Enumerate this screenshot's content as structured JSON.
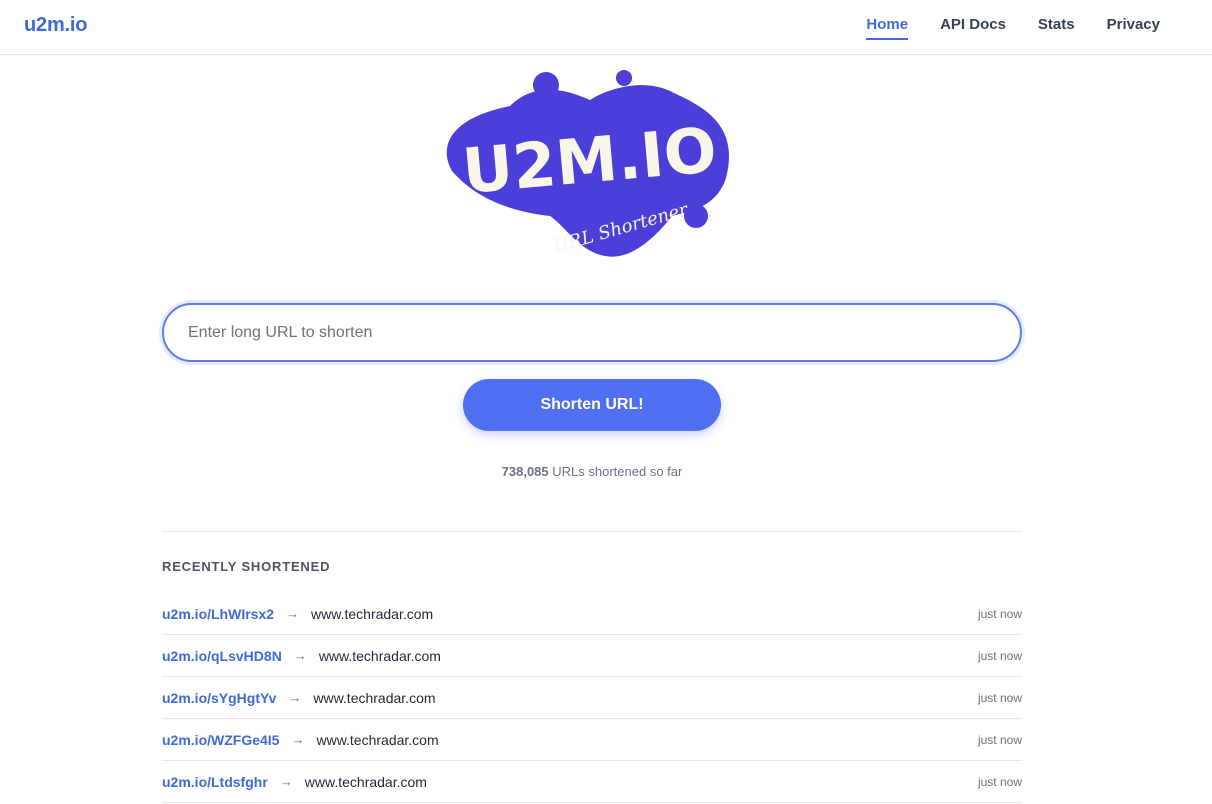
{
  "header": {
    "brand": "u2m.io",
    "nav": [
      {
        "label": "Home",
        "active": true
      },
      {
        "label": "API Docs",
        "active": false
      },
      {
        "label": "Stats",
        "active": false
      },
      {
        "label": "Privacy",
        "active": false
      }
    ]
  },
  "logo": {
    "title": "U2M.IO",
    "tagline": "URL Shortener",
    "color": "#4c3fd9",
    "text_color": "#f7f6e8"
  },
  "form": {
    "placeholder": "Enter long URL to shorten",
    "value": "",
    "button_label": "Shorten URL!"
  },
  "stats": {
    "count": "738,085",
    "suffix": "URLs shortened so far"
  },
  "recent": {
    "heading": "RECENTLY SHORTENED",
    "arrow": "→",
    "items": [
      {
        "short": "u2m.io/LhWIrsx2",
        "dest": "www.techradar.com",
        "time": "just now"
      },
      {
        "short": "u2m.io/qLsvHD8N",
        "dest": "www.techradar.com",
        "time": "just now"
      },
      {
        "short": "u2m.io/sYgHgtYv",
        "dest": "www.techradar.com",
        "time": "just now"
      },
      {
        "short": "u2m.io/WZFGe4I5",
        "dest": "www.techradar.com",
        "time": "just now"
      },
      {
        "short": "u2m.io/Ltdsfghr",
        "dest": "www.techradar.com",
        "time": "just now"
      }
    ]
  },
  "colors": {
    "accent": "#3f6ad8",
    "button": "#4f6ef0",
    "border": "#e5e7eb"
  }
}
